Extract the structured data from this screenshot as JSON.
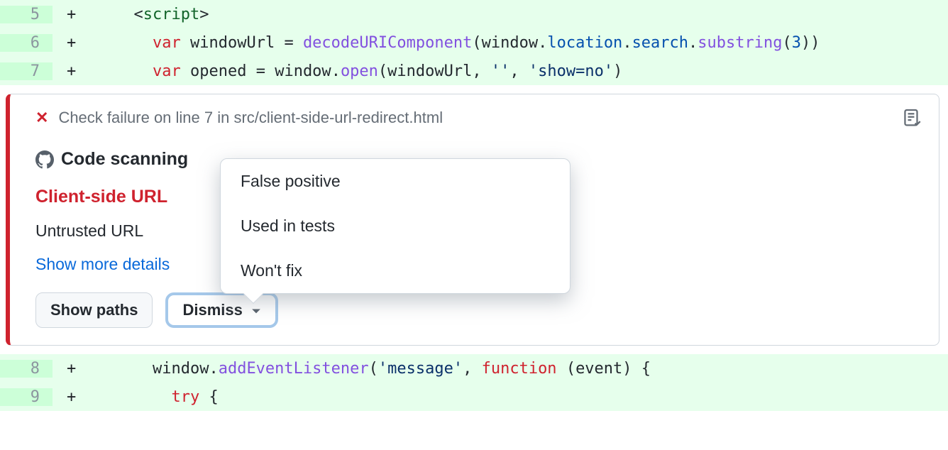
{
  "code_rows": [
    {
      "line": "5",
      "plus": "+",
      "tokens": [
        {
          "cls": "tok-punct",
          "t": "  <"
        },
        {
          "cls": "tok-tag",
          "t": "script"
        },
        {
          "cls": "tok-punct",
          "t": ">"
        }
      ]
    },
    {
      "line": "6",
      "plus": "+",
      "tokens": [
        {
          "cls": "tok-id",
          "t": "    "
        },
        {
          "cls": "tok-kw",
          "t": "var"
        },
        {
          "cls": "tok-id",
          "t": " windowUrl "
        },
        {
          "cls": "tok-punct",
          "t": "= "
        },
        {
          "cls": "tok-func",
          "t": "decodeURIComponent"
        },
        {
          "cls": "tok-punct",
          "t": "("
        },
        {
          "cls": "tok-id",
          "t": "window"
        },
        {
          "cls": "tok-punct",
          "t": "."
        },
        {
          "cls": "tok-prop",
          "t": "location"
        },
        {
          "cls": "tok-punct",
          "t": "."
        },
        {
          "cls": "tok-prop",
          "t": "search"
        },
        {
          "cls": "tok-punct",
          "t": "."
        },
        {
          "cls": "tok-func",
          "t": "substring"
        },
        {
          "cls": "tok-punct",
          "t": "("
        },
        {
          "cls": "tok-num",
          "t": "3"
        },
        {
          "cls": "tok-punct",
          "t": "))"
        }
      ]
    },
    {
      "line": "7",
      "plus": "+",
      "tokens": [
        {
          "cls": "tok-id",
          "t": "    "
        },
        {
          "cls": "tok-kw",
          "t": "var"
        },
        {
          "cls": "tok-id",
          "t": " opened "
        },
        {
          "cls": "tok-punct",
          "t": "= "
        },
        {
          "cls": "tok-id",
          "t": "window"
        },
        {
          "cls": "tok-punct",
          "t": "."
        },
        {
          "cls": "tok-func",
          "t": "open"
        },
        {
          "cls": "tok-punct",
          "t": "("
        },
        {
          "cls": "tok-id",
          "t": "windowUrl"
        },
        {
          "cls": "tok-punct",
          "t": ", "
        },
        {
          "cls": "tok-str",
          "t": "''"
        },
        {
          "cls": "tok-punct",
          "t": ", "
        },
        {
          "cls": "tok-str",
          "t": "'show=no'"
        },
        {
          "cls": "tok-punct",
          "t": ")"
        }
      ]
    }
  ],
  "code_rows_bottom": [
    {
      "line": "8",
      "plus": "+",
      "tokens": [
        {
          "cls": "tok-id",
          "t": "    window"
        },
        {
          "cls": "tok-punct",
          "t": "."
        },
        {
          "cls": "tok-func",
          "t": "addEventListener"
        },
        {
          "cls": "tok-punct",
          "t": "("
        },
        {
          "cls": "tok-str",
          "t": "'message'"
        },
        {
          "cls": "tok-punct",
          "t": ", "
        },
        {
          "cls": "tok-kw",
          "t": "function"
        },
        {
          "cls": "tok-id",
          "t": " "
        },
        {
          "cls": "tok-punct",
          "t": "("
        },
        {
          "cls": "tok-id",
          "t": "event"
        },
        {
          "cls": "tok-punct",
          "t": ") {"
        }
      ]
    },
    {
      "line": "9",
      "plus": "+",
      "tokens": [
        {
          "cls": "tok-id",
          "t": "      "
        },
        {
          "cls": "tok-kw",
          "t": "try"
        },
        {
          "cls": "tok-punct",
          "t": " {"
        }
      ]
    }
  ],
  "alert": {
    "close_glyph": "✕",
    "failure_text": "Check failure on line 7 in src/client-side-url-redirect.html",
    "section_title": "Code scanning",
    "vuln_title": "Client-side URL",
    "vuln_desc": "Untrusted URL",
    "details_link": "Show more details",
    "show_paths_label": "Show paths",
    "dismiss_label": "Dismiss"
  },
  "popover": {
    "items": [
      "False positive",
      "Used in tests",
      "Won't fix"
    ]
  }
}
